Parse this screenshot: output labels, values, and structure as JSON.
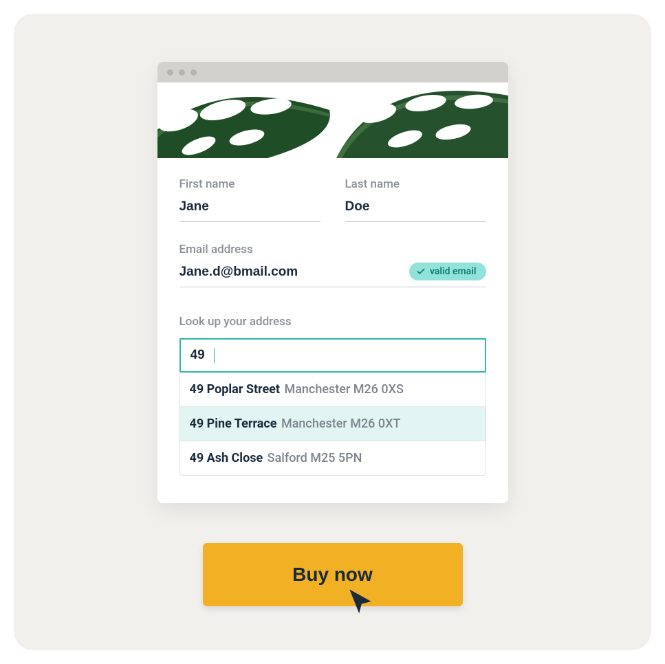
{
  "form": {
    "first_name_label": "First name",
    "first_name_value": "Jane",
    "last_name_label": "Last name",
    "last_name_value": "Doe",
    "email_label": "Email address",
    "email_value": "Jane.d@bmail.com",
    "email_badge": "valid email",
    "address_label": "Look up your address",
    "address_value": "49",
    "suggestions": [
      {
        "bold": "49 Poplar Street",
        "rest": "Manchester M26 0XS",
        "highlighted": false
      },
      {
        "bold": "49 Pine Terrace",
        "rest": "Manchester M26 0XT",
        "highlighted": true
      },
      {
        "bold": "49 Ash Close",
        "rest": "Salford M25 5PN",
        "highlighted": false
      }
    ]
  },
  "cta": {
    "label": "Buy now"
  }
}
